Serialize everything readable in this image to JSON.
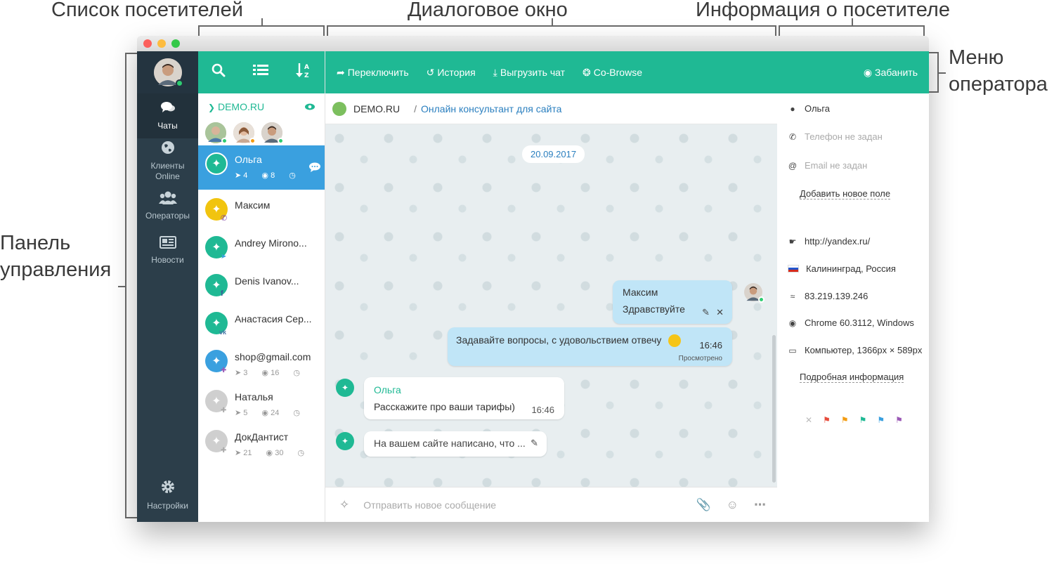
{
  "annotations": {
    "visitor_list": "Список посетителей",
    "dialog_window": "Диалоговое окно",
    "visitor_info": "Информация о посетителе",
    "operator_menu_line1": "Меню",
    "operator_menu_line2": "оператора",
    "control_panel_line1": "Панель",
    "control_panel_line2": "управления"
  },
  "nav": {
    "items": [
      {
        "label": "Чаты",
        "icon": "chat-bubbles-icon"
      },
      {
        "label": "Клиенты Online",
        "icon": "globe-icon"
      },
      {
        "label": "Операторы",
        "icon": "users-icon"
      },
      {
        "label": "Новости",
        "icon": "newspaper-icon"
      }
    ],
    "settings_label": "Настройки"
  },
  "visitor_list": {
    "site": "DEMO.RU",
    "visitors": [
      {
        "name": "Ольга",
        "stat1": "4",
        "stat2": "8"
      },
      {
        "name": "Максим"
      },
      {
        "name": "Andrey Mirono..."
      },
      {
        "name": "Denis Ivanov..."
      },
      {
        "name": "Анастасия Сер..."
      },
      {
        "name": "shop@gmail.com",
        "stat1": "3",
        "stat2": "16"
      },
      {
        "name": "Наталья",
        "stat1": "5",
        "stat2": "24"
      },
      {
        "name": "ДокДантист",
        "stat1": "21",
        "stat2": "30"
      }
    ]
  },
  "toolbar": {
    "switch_label": "Переключить",
    "history_label": "История",
    "export_label": "Выгрузить чат",
    "cobrowse_label": "Co-Browse",
    "ban_label": "Забанить"
  },
  "chat": {
    "site": "DEMO.RU",
    "separator": "/",
    "description": "Онлайн консультант для сайта",
    "date": "20.09.2017",
    "messages": [
      {
        "author": "Максим",
        "text": "Здравствуйте"
      },
      {
        "text": "Задавайте вопросы, с удовольствием отвечу",
        "time": "16:46",
        "status": "Просмотрено"
      },
      {
        "author": "Ольга",
        "text": "Расскажите про ваши тарифы)",
        "time": "16:46"
      },
      {
        "text": "На вашем сайте написано, что ..."
      }
    ],
    "input_placeholder": "Отправить новое сообщение"
  },
  "info": {
    "name": "Ольга",
    "phone": "Телефон не задан",
    "email": "Email не задан",
    "add_field": "Добавить новое поле",
    "url": "http://yandex.ru/",
    "location": "Калининград, Россия",
    "ip": "83.219.139.246",
    "browser": "Chrome 60.3112, Windows",
    "device": "Компьютер, 1366px × 589px",
    "details": "Подробная информация"
  },
  "colors": {
    "accent": "#1fb994",
    "nav_bg": "#2c3e4a",
    "active_visitor": "#3aa0df",
    "operator_bubble": "#c0e5f7",
    "flags": [
      "#e74c3c",
      "#f39c12",
      "#1fb994",
      "#3aa0df",
      "#9b59b6"
    ]
  }
}
